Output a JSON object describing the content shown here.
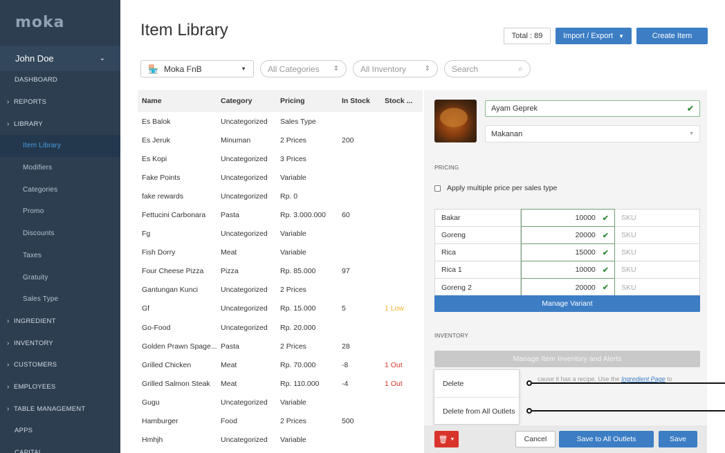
{
  "sidebar": {
    "logo": "moka",
    "user": "John Doe",
    "items": [
      {
        "label": "DASHBOARD",
        "type": "top",
        "arrow": ""
      },
      {
        "label": "REPORTS",
        "type": "top",
        "arrow": "›"
      },
      {
        "label": "LIBRARY",
        "type": "top",
        "arrow": "›"
      },
      {
        "label": "Item Library",
        "type": "sub",
        "active": true
      },
      {
        "label": "Modifiers",
        "type": "sub"
      },
      {
        "label": "Categories",
        "type": "sub"
      },
      {
        "label": "Promo",
        "type": "sub"
      },
      {
        "label": "Discounts",
        "type": "sub"
      },
      {
        "label": "Taxes",
        "type": "sub"
      },
      {
        "label": "Gratuity",
        "type": "sub"
      },
      {
        "label": "Sales Type",
        "type": "sub"
      },
      {
        "label": "INGREDIENT",
        "type": "top",
        "arrow": "›"
      },
      {
        "label": "INVENTORY",
        "type": "top",
        "arrow": "›"
      },
      {
        "label": "CUSTOMERS",
        "type": "top",
        "arrow": "›"
      },
      {
        "label": "EMPLOYEES",
        "type": "top",
        "arrow": "›"
      },
      {
        "label": "TABLE MANAGEMENT",
        "type": "top",
        "arrow": "›"
      },
      {
        "label": "APPS",
        "type": "top",
        "arrow": ""
      },
      {
        "label": "CAPITAL",
        "type": "top",
        "arrow": ""
      }
    ]
  },
  "header": {
    "title": "Item Library",
    "total": "Total : 89",
    "import_export": "Import / Export",
    "create_item": "Create Item"
  },
  "filters": {
    "outlet": "Moka FnB",
    "categories": "All Categories",
    "inventory": "All Inventory",
    "search_placeholder": "Search"
  },
  "table": {
    "columns": [
      "Name",
      "Category",
      "Pricing",
      "In Stock",
      "Stock ..."
    ],
    "rows": [
      [
        "Es Balok",
        "Uncategorized",
        "Sales Type",
        "",
        ""
      ],
      [
        "Es Jeruk",
        "Minuman",
        "2 Prices",
        "200",
        ""
      ],
      [
        "Es Kopi",
        "Uncategorized",
        "3 Prices",
        "",
        ""
      ],
      [
        "Fake Points",
        "Uncategorized",
        "Variable",
        "",
        ""
      ],
      [
        "fake rewards",
        "Uncategorized",
        "Rp. 0",
        "",
        ""
      ],
      [
        "Fettucini Carbonara",
        "Pasta",
        "Rp. 3.000.000",
        "60",
        ""
      ],
      [
        "Fg",
        "Uncategorized",
        "Variable",
        "",
        ""
      ],
      [
        "Fish Dorry",
        "Meat",
        "Variable",
        "",
        ""
      ],
      [
        "Four Cheese Pizza",
        "Pizza",
        "Rp. 85.000",
        "97",
        ""
      ],
      [
        "Gantungan Kunci",
        "Uncategorized",
        "2 Prices",
        "",
        ""
      ],
      [
        "Gf",
        "Uncategorized",
        "Rp. 15.000",
        "5",
        "1 Low"
      ],
      [
        "Go-Food",
        "Uncategorized",
        "Rp. 20.000",
        "",
        ""
      ],
      [
        "Golden Prawn Spage...",
        "Pasta",
        "2 Prices",
        "28",
        ""
      ],
      [
        "Grilled Chicken",
        "Meat",
        "Rp. 70.000",
        "-8",
        "1 Out"
      ],
      [
        "Grilled Salmon Steak",
        "Meat",
        "Rp. 110.000",
        "-4",
        "1 Out"
      ],
      [
        "Gugu",
        "Uncategorized",
        "Variable",
        "",
        ""
      ],
      [
        "Hamburger",
        "Food",
        "2 Prices",
        "500",
        ""
      ],
      [
        "Hmhjh",
        "Uncategorized",
        "Variable",
        "",
        ""
      ]
    ]
  },
  "detail": {
    "item_name": "Ayam Geprek",
    "category": "Makanan",
    "pricing_label": "PRICING",
    "apply_multi": "Apply multiple price per sales type",
    "variants": [
      {
        "name": "Bakar",
        "price": "10000",
        "sku": "SKU"
      },
      {
        "name": "Goreng",
        "price": "20000",
        "sku": "SKU"
      },
      {
        "name": "Rica",
        "price": "15000",
        "sku": "SKU"
      },
      {
        "name": "Rica 1",
        "price": "10000",
        "sku": "SKU"
      },
      {
        "name": "Goreng 2",
        "price": "20000",
        "sku": "SKU"
      }
    ],
    "manage_variant": "Manage Variant",
    "inventory_label": "INVENTORY",
    "manage_inventory": "Manage Item Inventory and Alerts",
    "note_prefix": "cause it has a recipe. Use the ",
    "note_link": "Ingredient Page",
    "note_suffix": " to"
  },
  "delete_menu": {
    "delete": "Delete",
    "delete_all": "Delete from All Outlets"
  },
  "footer": {
    "cancel": "Cancel",
    "save_all": "Save to All Outlets",
    "save": "Save"
  },
  "colors": {
    "sidebar_bg": "#2c3e50",
    "primary": "#3c7dc4",
    "danger": "#d9342b",
    "success": "#3a8f3d",
    "warning": "#f0b429"
  }
}
